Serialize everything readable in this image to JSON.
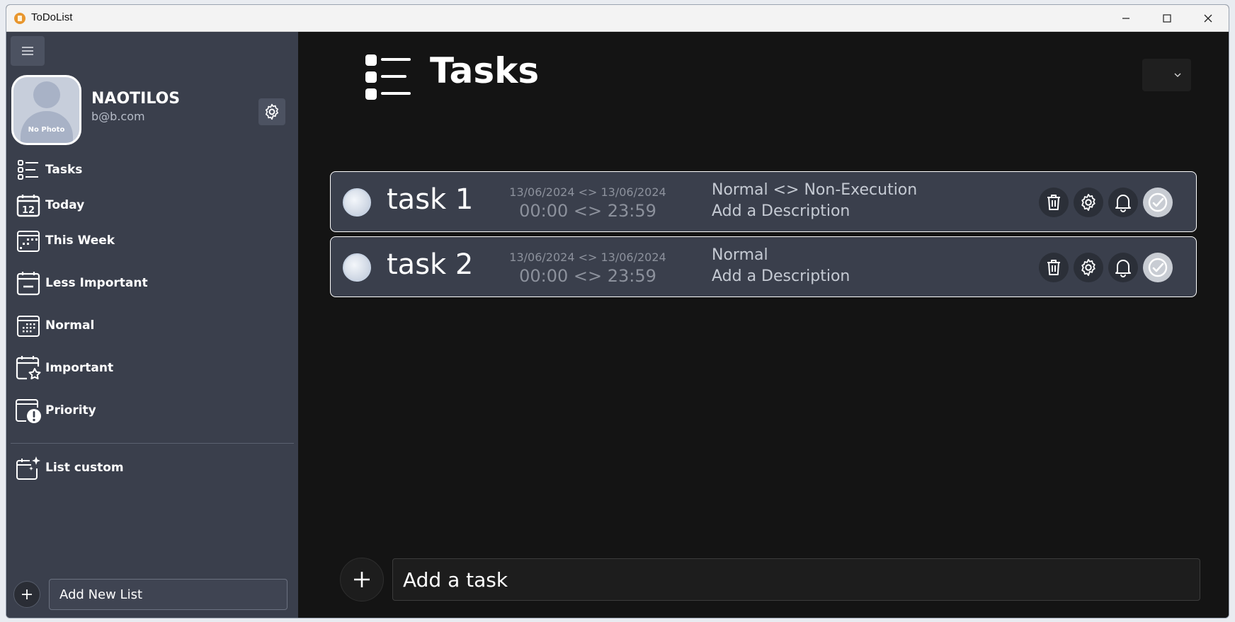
{
  "window": {
    "title": "ToDoList"
  },
  "sidebar": {
    "user": {
      "name": "NAOTILOS",
      "email": "b@b.com",
      "avatar_text": "No Photo"
    },
    "items": [
      {
        "label": "Tasks",
        "icon": "list-icon"
      },
      {
        "label": "Today",
        "icon": "calendar-day-icon"
      },
      {
        "label": "This Week",
        "icon": "calendar-week-icon"
      },
      {
        "label": "Less Important",
        "icon": "calendar-minus-icon"
      },
      {
        "label": "Normal",
        "icon": "calendar-dots-icon"
      },
      {
        "label": "Important",
        "icon": "calendar-star-icon"
      },
      {
        "label": "Priority",
        "icon": "calendar-alert-icon"
      }
    ],
    "custom_lists": [
      {
        "label": "List custom",
        "icon": "calendar-sparkle-icon"
      }
    ],
    "add_list": {
      "label": "Add New List"
    }
  },
  "main": {
    "title": "Tasks",
    "tasks": [
      {
        "name": "task 1",
        "dates": "13/06/2024 <> 13/06/2024",
        "times": "00:00 <> 23:59",
        "meta": "Normal <> Non-Execution",
        "description": "Add a Description"
      },
      {
        "name": "task 2",
        "dates": "13/06/2024 <> 13/06/2024",
        "times": "00:00 <> 23:59",
        "meta": "Normal",
        "description": "Add a Description"
      }
    ],
    "add_task": {
      "label": "Add a task"
    }
  },
  "colors": {
    "sidebar_bg": "#3a3f4c",
    "main_bg": "#141414",
    "card_bg": "#3a3f4c",
    "card_border": "#ffffff",
    "text_primary": "#ffffff",
    "text_muted": "#8c919c"
  }
}
